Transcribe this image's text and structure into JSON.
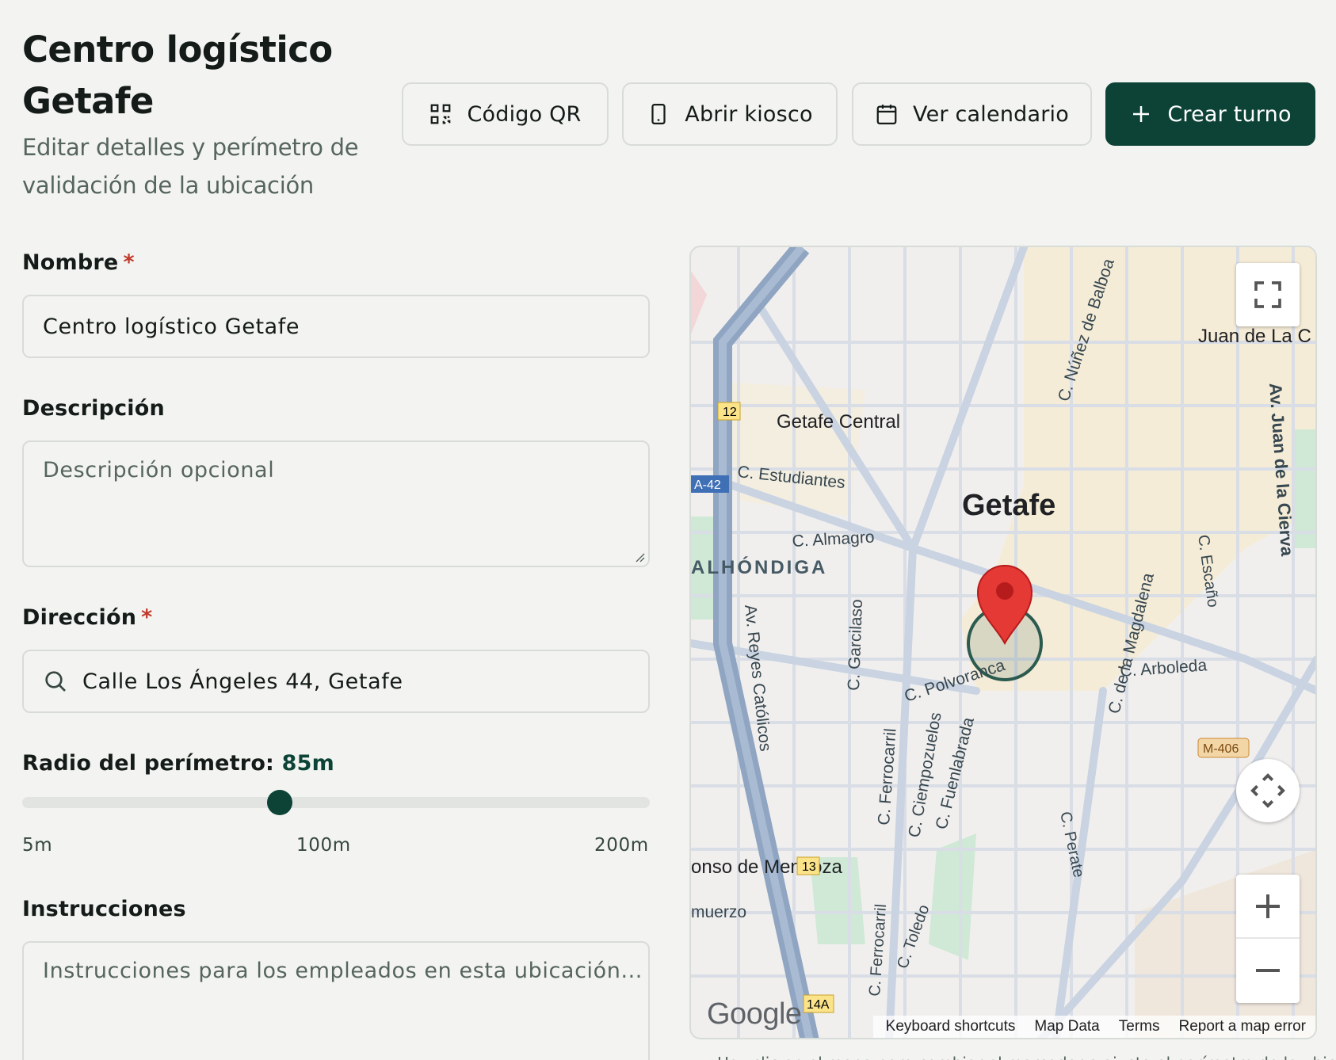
{
  "header": {
    "title": "Centro logístico Getafe",
    "subtitle": "Editar detalles y perímetro de validación de la ubicación"
  },
  "toolbar": {
    "qr_label": "Código QR",
    "kiosk_label": "Abrir kiosco",
    "calendar_label": "Ver calendario",
    "create_label": "Crear turno"
  },
  "form": {
    "name": {
      "label": "Nombre",
      "required_mark": "*",
      "value": "Centro logístico Getafe"
    },
    "description": {
      "label": "Descripción",
      "placeholder": "Descripción opcional",
      "value": ""
    },
    "address": {
      "label": "Dirección",
      "required_mark": "*",
      "value": "Calle Los Ángeles 44, Getafe"
    },
    "radius": {
      "label": "Radio del perímetro:",
      "value_text": "85m",
      "value_m": 85,
      "min_label": "5m",
      "mid_label": "100m",
      "max_label": "200m",
      "min": 5,
      "max": 200
    },
    "instructions": {
      "label": "Instrucciones",
      "placeholder": "Instrucciones para los empleados en esta ubicación...",
      "value": ""
    }
  },
  "map": {
    "labels": {
      "city": "Getafe",
      "station": "Getafe Central",
      "district": "ALHÓNDIGA",
      "neighborhood_ne": "Juan de La C",
      "station_sw": "onso de Mendoza",
      "area_sw": "muerzo"
    },
    "streets": [
      "C. Estudiantes",
      "C. Almagro",
      "C. Garcilaso",
      "Av. Reyes Católicos",
      "C. Polvoranca",
      "C. Ferrocarril",
      "C. Ciempozuelos",
      "C. Fuenlabrada",
      "C. Núñez de Balboa",
      "Av. Juan de la Cierva",
      "C. Escaño",
      "C. de la Magdalena",
      "C. Arboleda",
      "C. Perate",
      "C. Toledo",
      "C. Ferrocarril"
    ],
    "road_shields": [
      "12",
      "A-42",
      "13",
      "14A",
      "M-406"
    ],
    "attribution": {
      "logo": "Google",
      "keyboard": "Keyboard shortcuts",
      "data": "Map Data",
      "terms": "Terms",
      "report": "Report a map error"
    },
    "colors": {
      "marker": "#e53935",
      "perimeter": "#0c4336",
      "highway": "#8fa5c2"
    }
  },
  "caption": "Haz clic en el mapa para cambiar el marcador o ajusta el perímetro de la ubicación",
  "colors": {
    "accent": "#0c4336",
    "required": "#c0392b",
    "background": "#f3f4f1"
  }
}
